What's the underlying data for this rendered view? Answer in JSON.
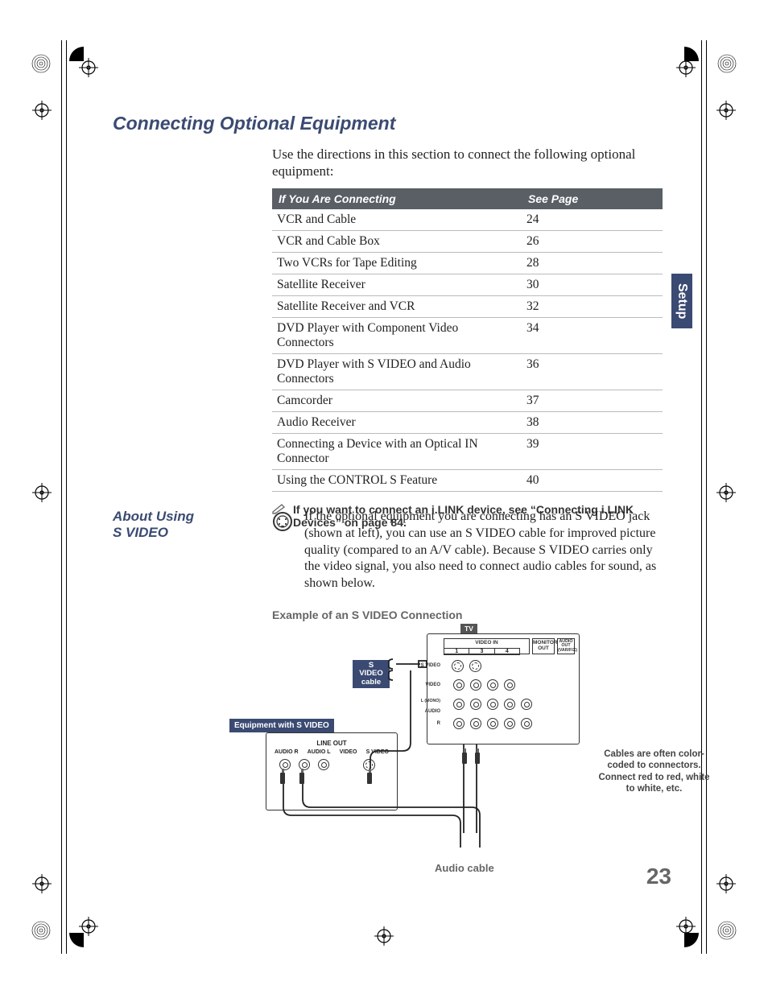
{
  "section_title": "Connecting Optional Equipment",
  "intro": "Use the directions in this section to connect the following optional equipment:",
  "table": {
    "header_connecting": "If You Are Connecting",
    "header_page": "See Page",
    "rows": [
      {
        "item": "VCR and Cable",
        "page": "24"
      },
      {
        "item": "VCR and Cable Box",
        "page": "26"
      },
      {
        "item": "Two VCRs for Tape Editing",
        "page": "28"
      },
      {
        "item": "Satellite Receiver",
        "page": "30"
      },
      {
        "item": "Satellite Receiver and VCR",
        "page": "32"
      },
      {
        "item": "DVD Player with Component Video Connectors",
        "page": "34"
      },
      {
        "item": "DVD Player with S VIDEO and Audio Connectors",
        "page": "36"
      },
      {
        "item": "Camcorder",
        "page": "37"
      },
      {
        "item": "Audio Receiver",
        "page": "38"
      },
      {
        "item": "Connecting a Device with an Optical IN Connector",
        "page": "39"
      },
      {
        "item": "Using the CONTROL S Feature",
        "page": "40"
      }
    ]
  },
  "note": "If you want to connect an i.LINK device, see “Connecting i.LINK Devices” on page 84.",
  "about_heading_1": "About Using",
  "about_heading_2": "S VIDEO",
  "svideo_text": "If the optional equipment you are connecting has an S VIDEO jack (shown at left), you can use an S VIDEO cable for improved picture quality (compared to an A/V cable). Because S VIDEO carries only the video signal, you also need to connect audio cables for sound, as shown below.",
  "example_title": "Example of an S VIDEO Connection",
  "diagram": {
    "tv_label": "TV",
    "panel_labels": {
      "video_in": "VIDEO IN",
      "col1": "1",
      "col3": "3",
      "col4": "4",
      "monitor_out": "MONITOR OUT",
      "audio_out": "AUDIO OUT (VAR/FIX)",
      "svideo": "S VIDEO",
      "video": "VIDEO",
      "l_mono": "L (MONO)",
      "audio": "AUDIO",
      "r": "R"
    },
    "svideo_cable_label_1": "S VIDEO",
    "svideo_cable_label_2": "cable",
    "equipment_label": "Equipment with S VIDEO",
    "equip_box": {
      "line_out": "LINE OUT",
      "audio_r": "AUDIO R",
      "audio_l": "AUDIO L",
      "video": "VIDEO",
      "svideo": "S VIDEO"
    },
    "audio_cable_label": "Audio cable",
    "callout": "Cables are often color-coded to connectors. Connect red to red, white to white, etc."
  },
  "side_tab": "Setup",
  "page_number": "23"
}
